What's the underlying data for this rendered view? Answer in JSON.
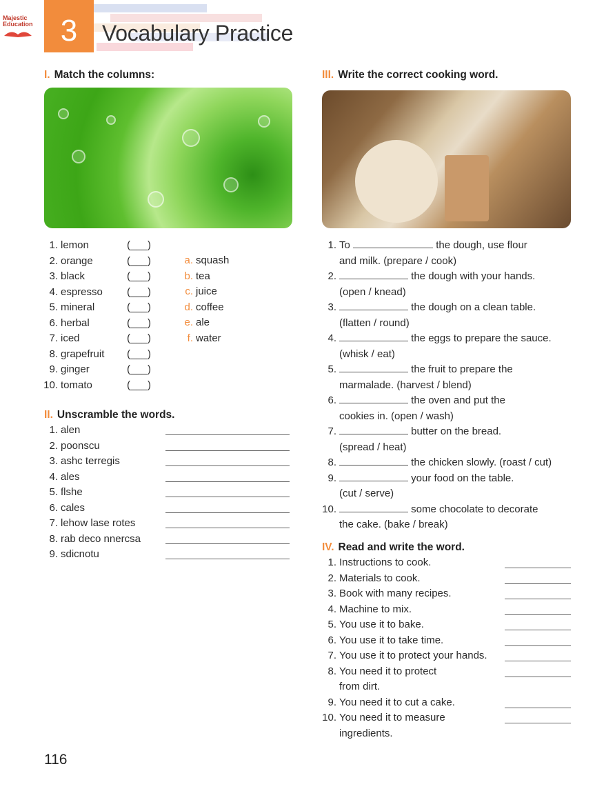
{
  "header": {
    "unit_number": "3",
    "title": "Vocabulary Practice",
    "logo_line1": "Majestic",
    "logo_line2": "Education"
  },
  "section1": {
    "num": "I.",
    "title": "Match the columns:",
    "left": [
      "lemon",
      "orange",
      "black",
      "espresso",
      "mineral",
      "herbal",
      "iced",
      "grapefruit",
      "ginger",
      "tomato"
    ],
    "paren": "(___)",
    "right": [
      {
        "letter": "a.",
        "word": "squash"
      },
      {
        "letter": "b.",
        "word": "tea"
      },
      {
        "letter": "c.",
        "word": "juice"
      },
      {
        "letter": "d.",
        "word": "coffee"
      },
      {
        "letter": "e.",
        "word": "ale"
      },
      {
        "letter": "f.",
        "word": "water"
      }
    ]
  },
  "section2": {
    "num": "II.",
    "title": "Unscramble the words.",
    "items": [
      "alen",
      "poonscu",
      "ashc terregis",
      "ales",
      "flshe",
      "cales",
      "lehow lase rotes",
      "rab deco nnercsa",
      "sdicnotu"
    ]
  },
  "section3": {
    "num": "III.",
    "title": "Write the correct cooking word.",
    "items": [
      {
        "num": "1.",
        "pre": "To",
        "post": "the dough, use flour",
        "line2": "and milk. (prepare / cook)"
      },
      {
        "num": "2.",
        "pre": "",
        "post": "the dough with your hands.",
        "line2": "(open / knead)"
      },
      {
        "num": "3.",
        "pre": "",
        "post": "the dough on a clean table.",
        "line2": "(flatten / round)"
      },
      {
        "num": "4.",
        "pre": "",
        "post": "the eggs to prepare the sauce.",
        "line2": "(whisk / eat)"
      },
      {
        "num": "5.",
        "pre": "",
        "post": "the fruit to prepare the",
        "line2": "marmalade. (harvest / blend)"
      },
      {
        "num": "6.",
        "pre": "",
        "post": "the oven and put the",
        "line2": "cookies in. (open / wash)"
      },
      {
        "num": "7.",
        "pre": "",
        "post": "butter on the bread.",
        "line2": "(spread / heat)"
      },
      {
        "num": "8.",
        "pre": "",
        "post": "the chicken slowly. (roast / cut)",
        "line2": ""
      },
      {
        "num": "9.",
        "pre": "",
        "post": "your food on the table.",
        "line2": "(cut / serve)"
      },
      {
        "num": "10.",
        "pre": "",
        "post": "some chocolate to decorate",
        "line2": "the cake. (bake / break)"
      }
    ]
  },
  "section4": {
    "num": "IV.",
    "title": "Read and write the word.",
    "items": [
      {
        "text": "Instructions to cook.",
        "line2": ""
      },
      {
        "text": "Materials to cook.",
        "line2": ""
      },
      {
        "text": "Book with many recipes.",
        "line2": ""
      },
      {
        "text": "Machine to mix.",
        "line2": ""
      },
      {
        "text": "You use it to bake.",
        "line2": ""
      },
      {
        "text": "You use it to take time.",
        "line2": ""
      },
      {
        "text": "You use it to protect your hands.",
        "line2": ""
      },
      {
        "text": "You need it to protect",
        "line2": "from dirt."
      },
      {
        "text": "You need it to cut a cake.",
        "line2": ""
      },
      {
        "text": "You need it to measure",
        "line2": "ingredients."
      }
    ]
  },
  "footer": {
    "page_number": "116"
  }
}
